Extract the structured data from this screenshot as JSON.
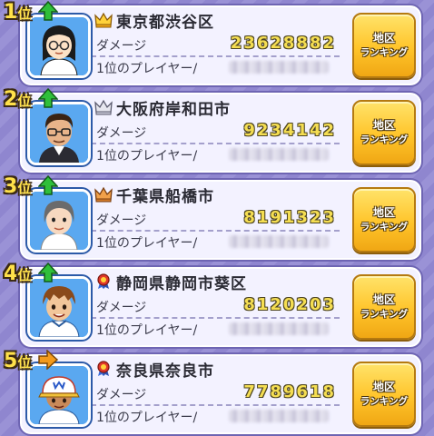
{
  "rankings": [
    {
      "rank": "1",
      "rank_suffix": "位",
      "trend": "up",
      "region_icon": "crown-gold-icon",
      "region": "東京都渋谷区",
      "damage_label": "ダメージ",
      "damage": "23628882",
      "top_player_label": "1位のプレイヤー/",
      "button_line1": "地区",
      "button_line2": "ランキング",
      "avatar": "girl-glasses"
    },
    {
      "rank": "2",
      "rank_suffix": "位",
      "trend": "up",
      "region_icon": "crown-silver-icon",
      "region": "大阪府岸和田市",
      "damage_label": "ダメージ",
      "damage": "9234142",
      "top_player_label": "1位のプレイヤー/",
      "button_line1": "地区",
      "button_line2": "ランキング",
      "avatar": "man-glasses"
    },
    {
      "rank": "3",
      "rank_suffix": "位",
      "trend": "up",
      "region_icon": "crown-bronze-icon",
      "region": "千葉県船橋市",
      "damage_label": "ダメージ",
      "damage": "8191323",
      "top_player_label": "1位のプレイヤー/",
      "button_line1": "地区",
      "button_line2": "ランキング",
      "avatar": "woman-gray"
    },
    {
      "rank": "4",
      "rank_suffix": "位",
      "trend": "up",
      "region_icon": "ribbon-medal-icon",
      "region": "静岡県静岡市葵区",
      "damage_label": "ダメージ",
      "damage": "8120203",
      "top_player_label": "1位のプレイヤー/",
      "button_line1": "地区",
      "button_line2": "ランキング",
      "avatar": "boy-brown"
    },
    {
      "rank": "5",
      "rank_suffix": "位",
      "trend": "same",
      "region_icon": "ribbon-medal-icon",
      "region": "奈良県奈良市",
      "damage_label": "ダメージ",
      "damage": "7789618",
      "top_player_label": "1位のプレイヤー/",
      "button_line1": "地区",
      "button_line2": "ランキング",
      "avatar": "kid-cap"
    }
  ],
  "colors": {
    "card_bg": "#f3f2ff",
    "card_border": "#6e65b3",
    "damage_text": "#f5de52",
    "button_gold": "#ffc42a",
    "rank_yellow": "#ffe14a",
    "trend_up": "#2fbf3a",
    "trend_same": "#f39a1c"
  }
}
